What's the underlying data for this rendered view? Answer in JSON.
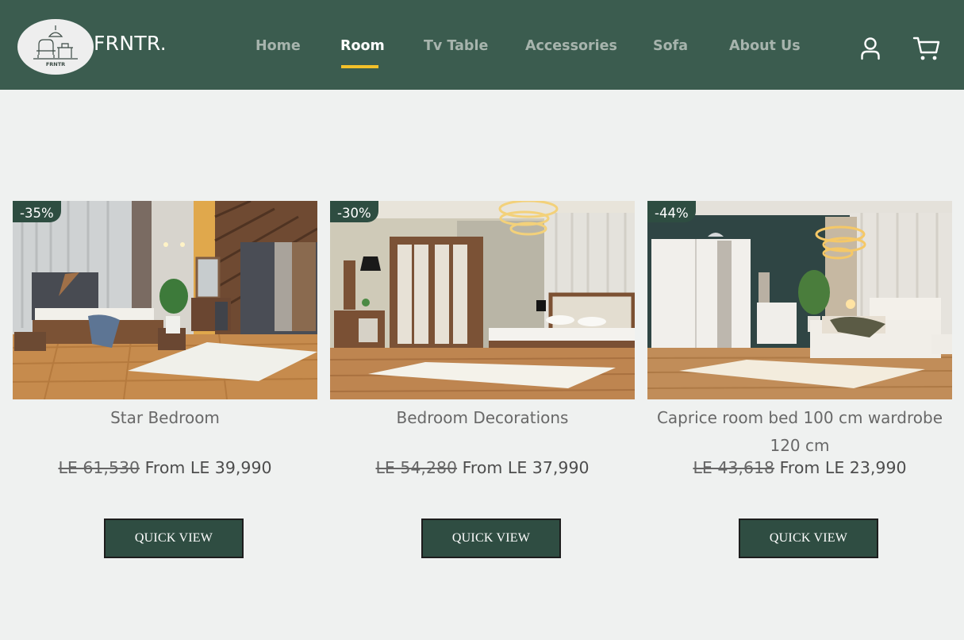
{
  "brand": {
    "name": "FRNTR.",
    "logo_text": "FRNTR"
  },
  "nav": {
    "items": [
      {
        "label": "Home"
      },
      {
        "label": "Room"
      },
      {
        "label": "Tv Table"
      },
      {
        "label": "Accessories"
      },
      {
        "label": "Sofa"
      },
      {
        "label": "About Us"
      }
    ],
    "active": "Room"
  },
  "header_icons": {
    "account": "user-icon",
    "cart": "cart-icon"
  },
  "colors": {
    "header_bg": "#3b5c4f",
    "accent": "#f3c12a",
    "button_bg": "#2f4d42",
    "page_bg": "#eff1f0"
  },
  "products": [
    {
      "discount": "-35%",
      "title": "Star Bedroom",
      "old_price": "LE 61,530",
      "price": "From LE 39,990",
      "button": "QUICK VIEW"
    },
    {
      "discount": "-30%",
      "title": "Bedroom Decorations",
      "old_price": "LE 54,280",
      "price": "From LE 37,990",
      "button": "QUICK VIEW"
    },
    {
      "discount": "-44%",
      "title": "Caprice room bed 100 cm wardrobe 120 cm",
      "old_price": "LE 43,618",
      "price": "From LE 23,990",
      "button": "QUICK VIEW"
    }
  ]
}
